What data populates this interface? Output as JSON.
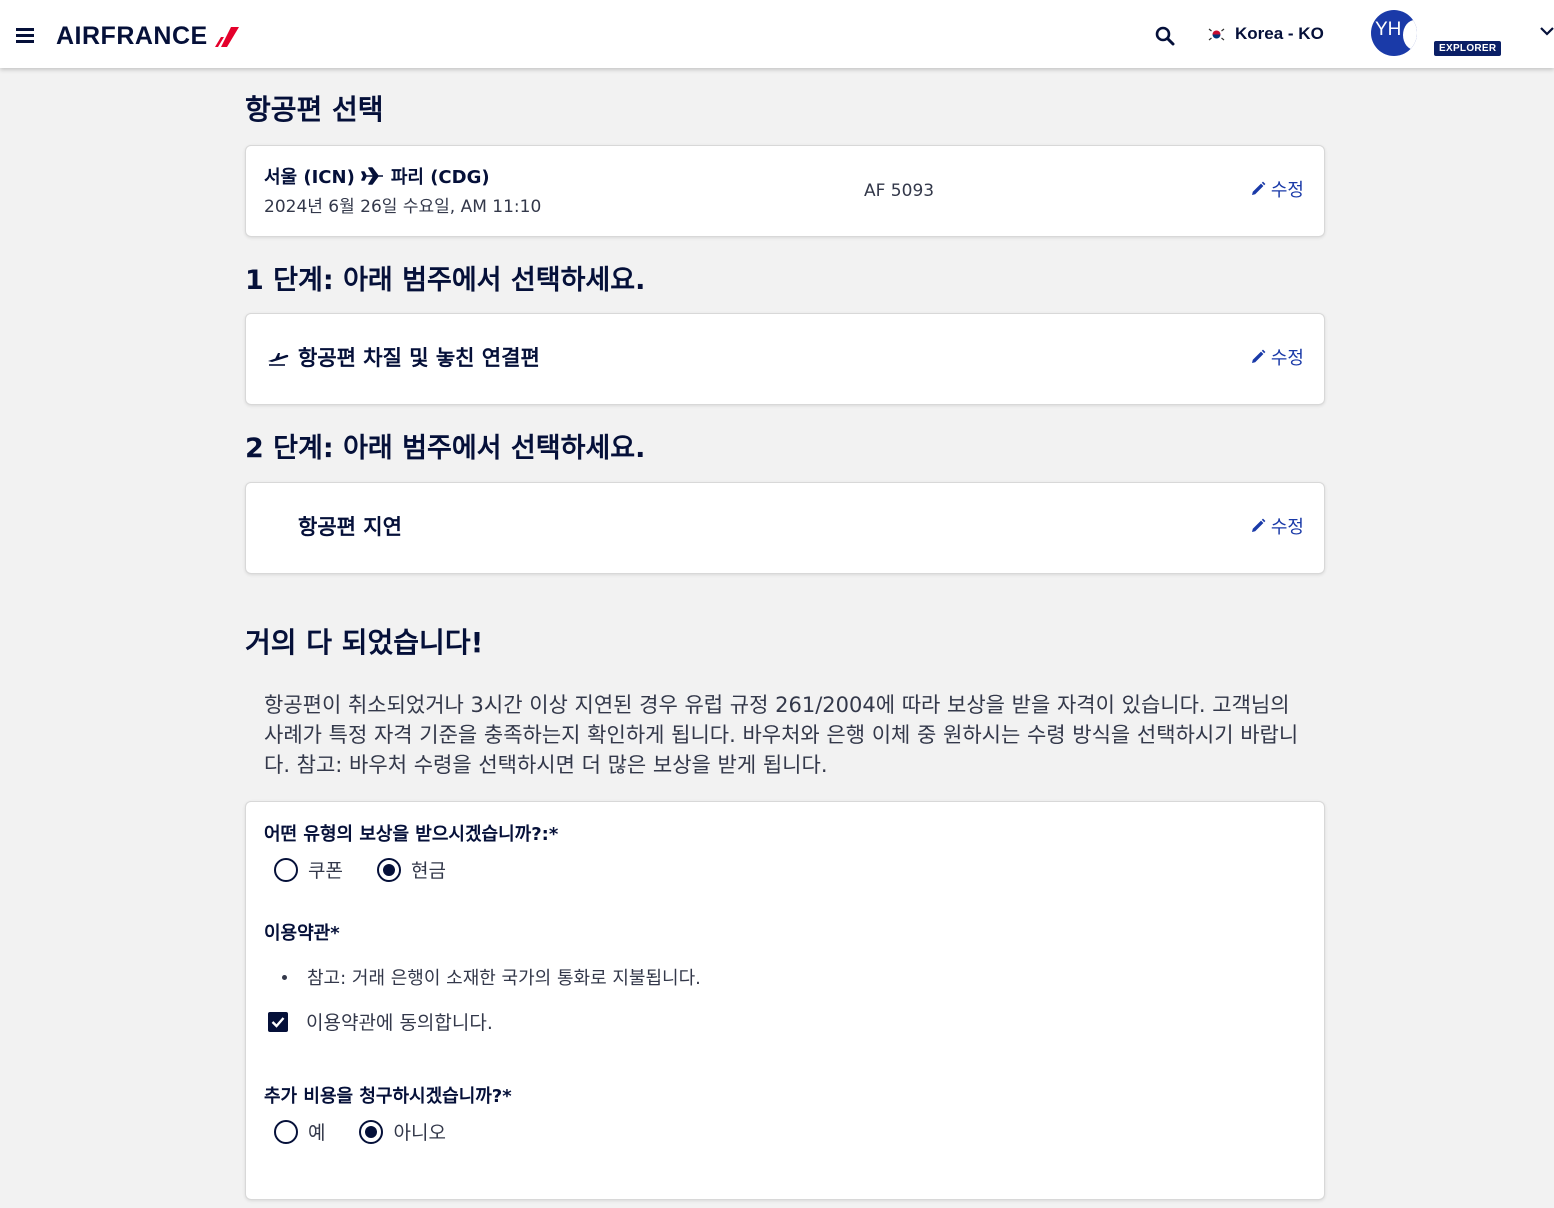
{
  "header": {
    "brand": "AIRFRANCE",
    "locale_label": "Korea - KO",
    "avatar_initials": "YH",
    "membership_badge": "EXPLORER"
  },
  "selected_flight": {
    "heading": "항공편 선택",
    "origin": "서울 (ICN)",
    "destination": "파리 (CDG)",
    "date_time": "2024년 6월 26일 수요일, AM 11:10",
    "flight_number": "AF 5093",
    "edit_label": "수정"
  },
  "step1": {
    "heading": "1 단계: 아래 범주에서 선택하세요.",
    "selection": "항공편 차질 및 놓친 연결편",
    "edit_label": "수정"
  },
  "step2": {
    "heading": "2 단계: 아래 범주에서 선택하세요.",
    "selection": "항공편 지연",
    "edit_label": "수정"
  },
  "almost_done": {
    "heading": "거의 다 되었습니다!",
    "description": "항공편이 취소되었거나 3시간 이상 지연된 경우 유럽 규정 261/2004에 따라 보상을 받을 자격이 있습니다. 고객님의 사례가 특정 자격 기준을 충족하는지 확인하게 됩니다. 바우처와 은행 이체 중 원하시는 수령 방식을 선택하시기 바랍니다. 참고: 바우처 수령을 선택하시면 더 많은 보상을 받게 됩니다."
  },
  "form": {
    "compensation_question": "어떤 유형의 보상을 받으시겠습니까?:*",
    "compensation_options": [
      {
        "label": "쿠폰",
        "selected": false
      },
      {
        "label": "현금",
        "selected": true
      }
    ],
    "terms_heading": "이용약관*",
    "terms_note": "참고: 거래 은행이 소재한 국가의 통화로 지불됩니다.",
    "terms_agree_label": "이용약관에 동의합니다.",
    "terms_agreed": true,
    "extra_costs_question": "추가 비용을 청구하시겠습니까?*",
    "extra_costs_options": [
      {
        "label": "예",
        "selected": false
      },
      {
        "label": "아니오",
        "selected": true
      }
    ]
  },
  "colors": {
    "brand_navy": "#051039",
    "link_blue": "#1a3aa8",
    "logo_red": "#e4002b",
    "page_bg": "#f2f2f2"
  }
}
